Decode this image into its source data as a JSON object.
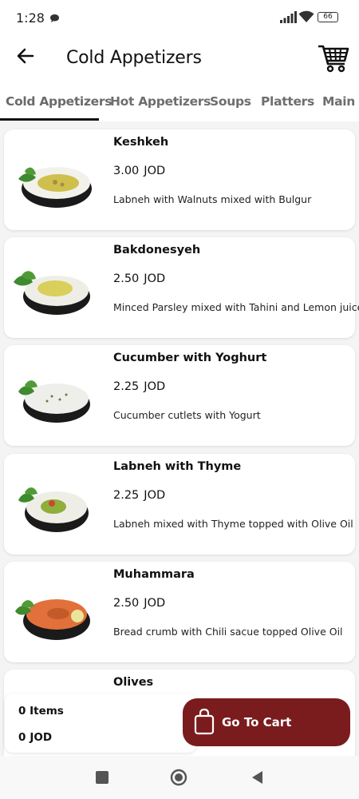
{
  "status": {
    "time": "1:28",
    "battery": "66"
  },
  "header": {
    "title": "Cold Appetizers"
  },
  "tabs": [
    "Cold Appetizers",
    "Hot Appetizers",
    "Soups",
    "Platters",
    "Main C"
  ],
  "products": [
    {
      "name": "Keshkeh",
      "price": "3.00",
      "currency": "JOD",
      "description": "Labneh with Walnuts mixed with Bulgur",
      "dish_color": "#cfc04d"
    },
    {
      "name": "Bakdonesyeh",
      "price": "2.50",
      "currency": "JOD",
      "description": "Minced Parsley mixed with Tahini and Lemon juice",
      "dish_color": "#d9cf5a"
    },
    {
      "name": "Cucumber with Yoghurt",
      "price": "2.25",
      "currency": "JOD",
      "description": "Cucumber cutlets with Yogurt",
      "dish_color": "#eeeeea"
    },
    {
      "name": "Labneh with Thyme",
      "price": "2.25",
      "currency": "JOD",
      "description": "Labneh mixed with Thyme topped with Olive Oil",
      "dish_color": "#8fae3c"
    },
    {
      "name": "Muhammara",
      "price": "2.50",
      "currency": "JOD",
      "description": "Bread crumb with Chili sacue topped Olive Oil",
      "dish_color": "#e2703a"
    },
    {
      "name": "Olives",
      "price": "",
      "currency": "",
      "description": "",
      "dish_color": "#6b7a3a"
    }
  ],
  "summary": {
    "items": "0 Items",
    "total_amount": "0",
    "total_currency": "JOD"
  },
  "cart_button": {
    "label": "Go To Cart"
  },
  "colors": {
    "accent": "#7a1c1e",
    "list_background": "#f4f4f4"
  },
  "icons": {
    "back": "arrow-left-icon",
    "cart": "shopping-cart-icon",
    "bag": "shopping-bag-icon"
  }
}
